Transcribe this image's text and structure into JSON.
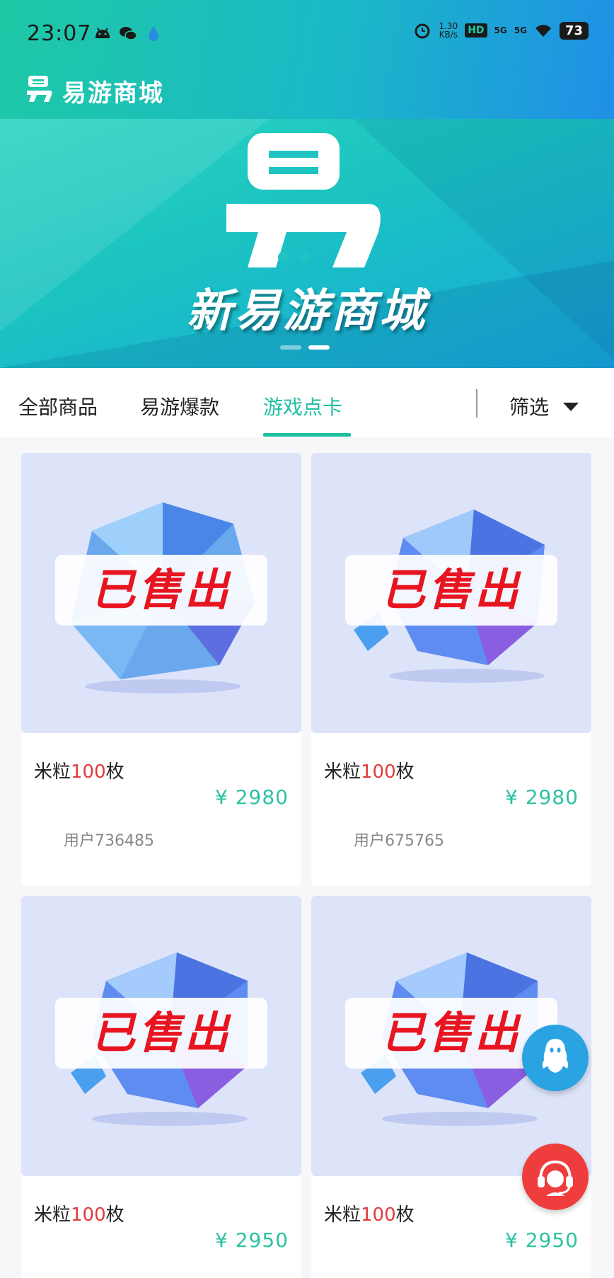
{
  "status_bar": {
    "time": "23:07",
    "net_speed_value": "1.30",
    "net_speed_unit": "KB/s",
    "hd_label": "HD",
    "sig1": "5G",
    "sig2": "5G",
    "battery": "73"
  },
  "app_bar": {
    "title": "易游商城"
  },
  "banner": {
    "big_char": "易",
    "title": "新易游商城",
    "slides": 2,
    "active_slide": 2
  },
  "tabs": {
    "items": [
      {
        "label": "全部商品"
      },
      {
        "label": "易游爆款"
      },
      {
        "label": "游戏点卡"
      }
    ],
    "active": 2,
    "filter_label": "筛选"
  },
  "products": [
    {
      "name_prefix": "米粒",
      "name_num": "100",
      "name_suffix": "枚",
      "price": "¥ 2980",
      "user": "用户736485",
      "badge": "已售出"
    },
    {
      "name_prefix": "米粒",
      "name_num": "100",
      "name_suffix": "枚",
      "price": "¥ 2980",
      "user": "用户675765",
      "badge": "已售出"
    },
    {
      "name_prefix": "米粒",
      "name_num": "100",
      "name_suffix": "枚",
      "price": "¥ 2950",
      "user": "",
      "badge": "已售出"
    },
    {
      "name_prefix": "米粒",
      "name_num": "100",
      "name_suffix": "枚",
      "price": "¥ 2950",
      "user": "",
      "badge": "已售出"
    }
  ],
  "colors": {
    "accent": "#1fbfa2",
    "price": "#2cc2a2",
    "sold": "#e8141f",
    "qq_button": "#2aa3e3",
    "service_button": "#ef3d3d"
  },
  "icons": {
    "status": [
      "android-icon",
      "wechat-icon",
      "drop-icon",
      "alarm-icon",
      "wifi-icon"
    ],
    "fab": [
      "qq-penguin-icon",
      "customer-service-headset-icon"
    ]
  }
}
